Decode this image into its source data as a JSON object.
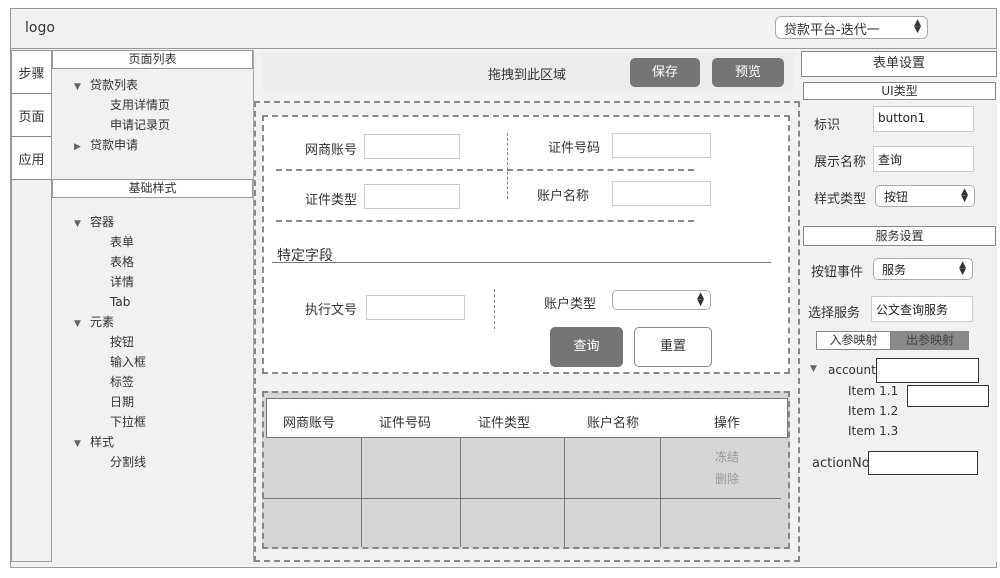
{
  "header": {
    "logo": "logo",
    "project_select": "贷款平台-迭代一"
  },
  "vtabs": [
    {
      "label": "步骤"
    },
    {
      "label": "页面"
    },
    {
      "label": "应用"
    }
  ],
  "left_panel": {
    "pages_title": "页面列表",
    "pages": [
      {
        "label": "贷款列表",
        "level": 1,
        "caret": "▼"
      },
      {
        "label": "支用详情页",
        "level": 2
      },
      {
        "label": "申请记录页",
        "level": 2
      },
      {
        "label": "贷款申请",
        "level": 1,
        "caret": "▶"
      }
    ],
    "basic_title": "基础样式",
    "components": [
      {
        "label": "容器",
        "level": 1,
        "caret": "▼"
      },
      {
        "label": "表单",
        "level": 2
      },
      {
        "label": "表格",
        "level": 2
      },
      {
        "label": "详情",
        "level": 2
      },
      {
        "label": "Tab",
        "level": 2
      },
      {
        "label": "元素",
        "level": 1,
        "caret": "▼"
      },
      {
        "label": "按钮",
        "level": 2
      },
      {
        "label": "输入框",
        "level": 2
      },
      {
        "label": "标签",
        "level": 2
      },
      {
        "label": "日期",
        "level": 2
      },
      {
        "label": "下拉框",
        "level": 2
      },
      {
        "label": "样式",
        "level": 1,
        "caret": "▼"
      },
      {
        "label": "分割线",
        "level": 2
      }
    ]
  },
  "toolbar": {
    "drop_hint": "拖拽到此区域",
    "save_label": "保存",
    "preview_label": "预览"
  },
  "form": {
    "fields": [
      {
        "label": "网商账号",
        "value": ""
      },
      {
        "label": "证件号码",
        "value": ""
      },
      {
        "label": "证件类型",
        "value": ""
      },
      {
        "label": "账户名称",
        "value": ""
      }
    ],
    "section_title": "特定字段",
    "exec_label": "执行文号",
    "exec_value": "",
    "account_type_label": "账户类型",
    "account_type_value": "",
    "query_label": "查询",
    "reset_label": "重置"
  },
  "table": {
    "columns": [
      "网商账号",
      "证件号码",
      "证件类型",
      "账户名称",
      "操作"
    ],
    "actions": [
      "冻结",
      "删除"
    ]
  },
  "right_panel": {
    "form_settings_title": "表单设置",
    "ui_type_title": "UI类型",
    "id_label": "标识",
    "id_value": "button1",
    "display_label": "展示名称",
    "display_value": "查询",
    "style_label": "样式类型",
    "style_value": "按钮",
    "service_title": "服务设置",
    "event_label": "按钮事件",
    "event_value": "服务",
    "service_label": "选择服务",
    "service_value": "公文查询服务",
    "map_in_tab": "入参映射",
    "map_out_tab": "出参映射",
    "param_root": "account",
    "param_items": [
      "Item 1.1",
      "Item 1.2",
      "Item 1.3"
    ],
    "param_action": "actionNo"
  }
}
